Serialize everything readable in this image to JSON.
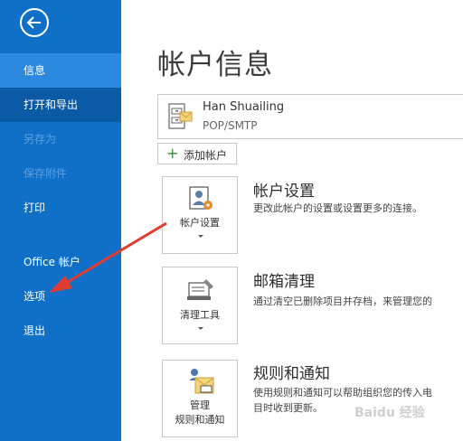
{
  "sidebar": {
    "items": [
      {
        "label": "信息"
      },
      {
        "label": "打开和导出"
      },
      {
        "label": "另存为"
      },
      {
        "label": "保存附件"
      },
      {
        "label": "打印"
      },
      {
        "label": "Office 帐户"
      },
      {
        "label": "选项"
      },
      {
        "label": "退出"
      }
    ]
  },
  "main": {
    "title": "帐户信息",
    "account": {
      "name": "Han Shuailing",
      "type": "POP/SMTP"
    },
    "add_account_label": "添加帐户",
    "sections": [
      {
        "tile_label": "帐户设置",
        "title": "帐户设置",
        "desc": "更改此帐户的设置或设置更多的连接。"
      },
      {
        "tile_label": "清理工具",
        "title": "邮箱清理",
        "desc": "通过清空已删除项目并存档，来管理您的"
      },
      {
        "tile_label_line1": "管理",
        "tile_label_line2": "规则和通知",
        "title": "规则和通知",
        "desc_line1": "使用规则和通知可以帮助组织您的传入电",
        "desc_line2": "目时收到更新。"
      }
    ]
  },
  "watermark": "Baidu 经验",
  "colors": {
    "sidebar": "#1070c8",
    "active": "#2b8ae0",
    "annotation_arrow": "#e03c31"
  }
}
